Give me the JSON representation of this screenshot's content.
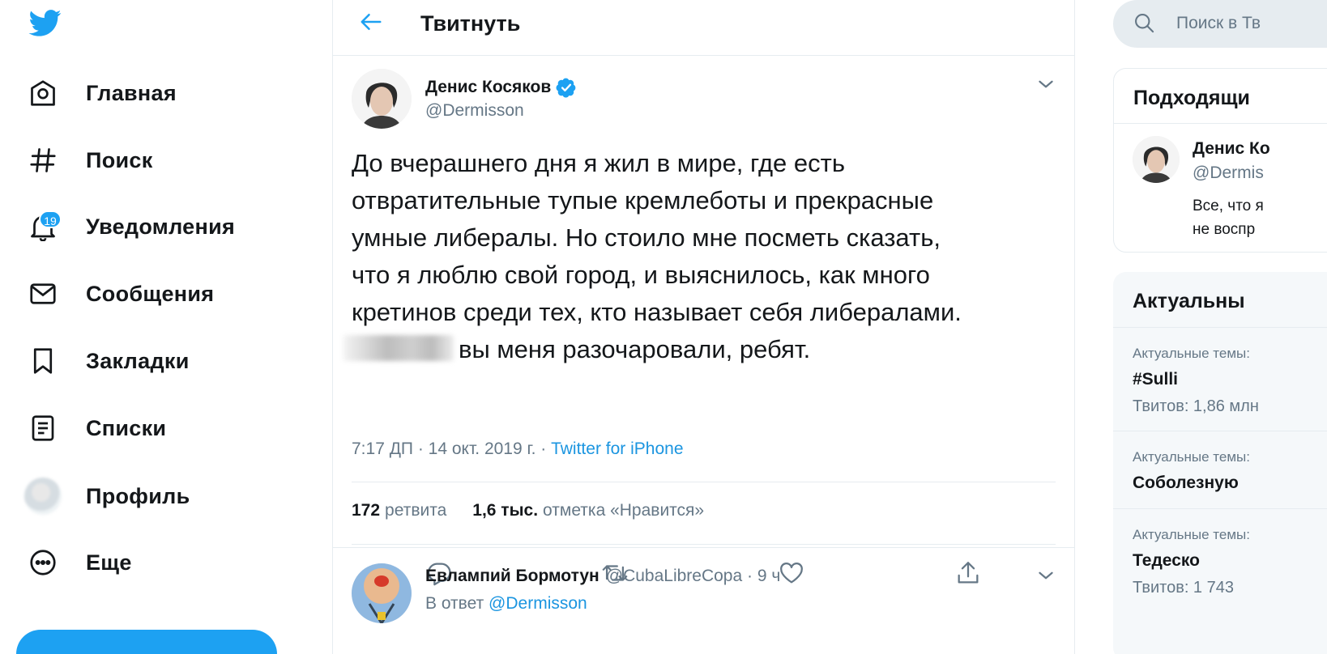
{
  "nav": {
    "items": [
      {
        "label": "Главная",
        "icon": "home-icon"
      },
      {
        "label": "Поиск",
        "icon": "hashtag-icon"
      },
      {
        "label": "Уведомления",
        "icon": "bell-icon",
        "badge": "19"
      },
      {
        "label": "Сообщения",
        "icon": "mail-icon"
      },
      {
        "label": "Закладки",
        "icon": "bookmark-icon"
      },
      {
        "label": "Списки",
        "icon": "list-icon"
      },
      {
        "label": "Профиль",
        "icon": "avatar"
      },
      {
        "label": "Еще",
        "icon": "more-icon"
      }
    ]
  },
  "header": {
    "title": "Твитнуть"
  },
  "tweet": {
    "author": "Денис Косяков",
    "handle": "@Dermisson",
    "text_lines": [
      "До вчерашнего дня я жил в мире, где есть",
      "отвратительные тупые кремлеботы и прекрасные",
      "умные либералы. Но стоило мне посметь сказать,",
      "что я люблю свой город, и выяснилось, как много",
      "кретинов среди тех, кто называет себя либералами."
    ],
    "last_line": "вы меня разочаровали, ребят.",
    "meta_time": "7:17 ДП · 14 окт. 2019 г. · ",
    "source": "Twitter for iPhone",
    "retweets_count": "172",
    "retweets_label": "ретвита",
    "likes_count": "1,6 тыс.",
    "likes_label": "отметка «Нравится»"
  },
  "reply": {
    "author": "Евлампий Бормотун",
    "handle_time": "@CubaLibreCopa · 9 ч",
    "reply_prefix": "В ответ",
    "reply_to": "@Dermisson"
  },
  "sidebar": {
    "search_placeholder": "Поиск в Тв",
    "suggest_title": "Подходящи",
    "suggest_user_name": "Денис Ко",
    "suggest_user_handle": "@Dermis",
    "suggest_bio_1": "Все, что я",
    "suggest_bio_2": "не воспр",
    "trends_title": "Актуальны",
    "trends": [
      {
        "category": "Актуальные темы:",
        "name": "#Sulli",
        "count": "Твитов: 1,86 млн"
      },
      {
        "category": "Актуальные темы:",
        "name": "Соболезную",
        "count": ""
      },
      {
        "category": "Актуальные темы:",
        "name": "Тедеско",
        "count": "Твитов: 1 743"
      }
    ]
  },
  "colors": {
    "accent": "#1da1f2",
    "text": "#14171a",
    "muted": "#657786",
    "border": "#e6ecf0"
  }
}
